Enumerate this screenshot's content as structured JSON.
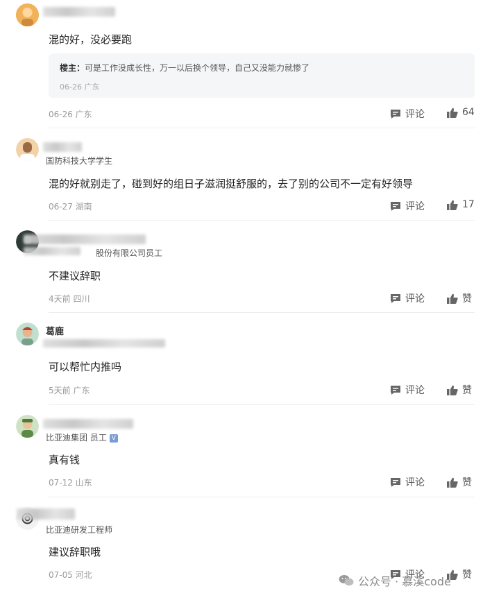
{
  "comments": [
    {
      "text": "混的好，没必要跑",
      "reply": {
        "author": "楼主：",
        "text": "可是工作没成长性，万一以后换个领导，自己又没能力就惨了",
        "meta": "06-26 广东"
      },
      "meta": "06-26 广东",
      "comment_label": "评论",
      "like_label": "64"
    },
    {
      "subtitle": "国防科技大学学生",
      "text": "混的好就别走了，碰到好的组日子滋润挺舒服的，去了别的公司不一定有好领导",
      "meta": "06-27 湖南",
      "comment_label": "评论",
      "like_label": "17"
    },
    {
      "subtitle": "股份有限公司员工",
      "text": "不建议辞职",
      "meta": "4天前 四川",
      "comment_label": "评论",
      "like_label": "赞"
    },
    {
      "name": "葛鹿",
      "text": "可以帮忙内推吗",
      "meta": "5天前 广东",
      "comment_label": "评论",
      "like_label": "赞"
    },
    {
      "subtitle": "比亚迪集团 员工",
      "text": "真有钱",
      "meta": "07-12 山东",
      "comment_label": "评论",
      "like_label": "赞"
    },
    {
      "subtitle": "比亚迪研发工程师",
      "text": "建议辞职哦",
      "meta": "07-05 河北",
      "comment_label": "评论",
      "like_label": "赞"
    }
  ],
  "watermark": "公众号 · 慕溪code"
}
